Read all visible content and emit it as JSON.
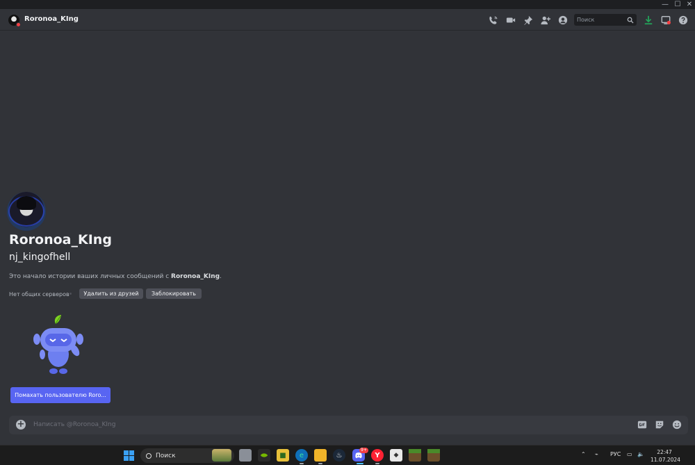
{
  "window": {
    "minimize": "—",
    "maximize": "☐",
    "close": "✕"
  },
  "header": {
    "name": "Roronoa_KIng",
    "search_placeholder": "Поиск",
    "icons": [
      "phone-call-icon",
      "video-call-icon",
      "pin-icon",
      "add-friend-icon",
      "user-profile-icon",
      "download-icon",
      "inbox-icon",
      "help-icon"
    ]
  },
  "profile": {
    "display_name": "Roronoa_KIng",
    "username": "nj_kingofhell",
    "intro_prefix": "Это начало истории ваших личных сообщений с ",
    "intro_name": "Roronoa_KIng",
    "intro_suffix": ".",
    "mutual_servers": "Нет общих серверов",
    "remove_friend": "Удалить из друзей",
    "block": "Заблокировать",
    "wave_button": "Помахать пользователю Roro..."
  },
  "composer": {
    "placeholder": "Написать @Roronoa_KIng"
  },
  "taskbar": {
    "search_label": "Поиск",
    "language": "РУС",
    "time": "22:47",
    "date": "11.07.2024",
    "discord_badge": "9+"
  },
  "colors": {
    "background": "#313338",
    "accent": "#5865f2",
    "status_dnd": "#f23f43",
    "download": "#23a55a"
  }
}
